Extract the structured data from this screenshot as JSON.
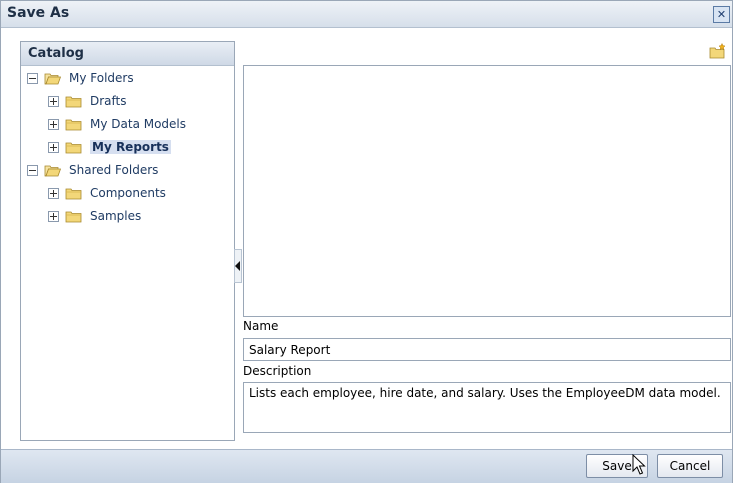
{
  "dialog": {
    "title": "Save As",
    "close_icon": "close-icon"
  },
  "catalog": {
    "header": "Catalog",
    "tree": [
      {
        "label": "My Folders",
        "expanded": true,
        "level": 0,
        "icon": "folder-open-icon"
      },
      {
        "label": "Drafts",
        "expanded": false,
        "level": 1,
        "icon": "folder-icon"
      },
      {
        "label": "My Data Models",
        "expanded": false,
        "level": 1,
        "icon": "folder-icon"
      },
      {
        "label": "My Reports",
        "expanded": false,
        "level": 1,
        "icon": "folder-icon",
        "selected": true
      },
      {
        "label": "Shared Folders",
        "expanded": true,
        "level": 0,
        "icon": "folder-open-icon"
      },
      {
        "label": "Components",
        "expanded": false,
        "level": 1,
        "icon": "folder-icon"
      },
      {
        "label": "Samples",
        "expanded": false,
        "level": 1,
        "icon": "folder-icon"
      }
    ]
  },
  "toolbar": {
    "new_folder_icon": "new-folder-icon"
  },
  "form": {
    "name_label": "Name",
    "name_value": "Salary Report",
    "description_label": "Description",
    "description_value": "Lists each employee, hire date, and salary. Uses the EmployeeDM data model."
  },
  "buttons": {
    "save_label": "Save",
    "cancel_label": "Cancel"
  },
  "colors": {
    "title_text": "#1e2f46",
    "tree_text": "#1f3b63",
    "selection_bg": "#d6dff0",
    "folder_yellow": "#f3d779"
  }
}
